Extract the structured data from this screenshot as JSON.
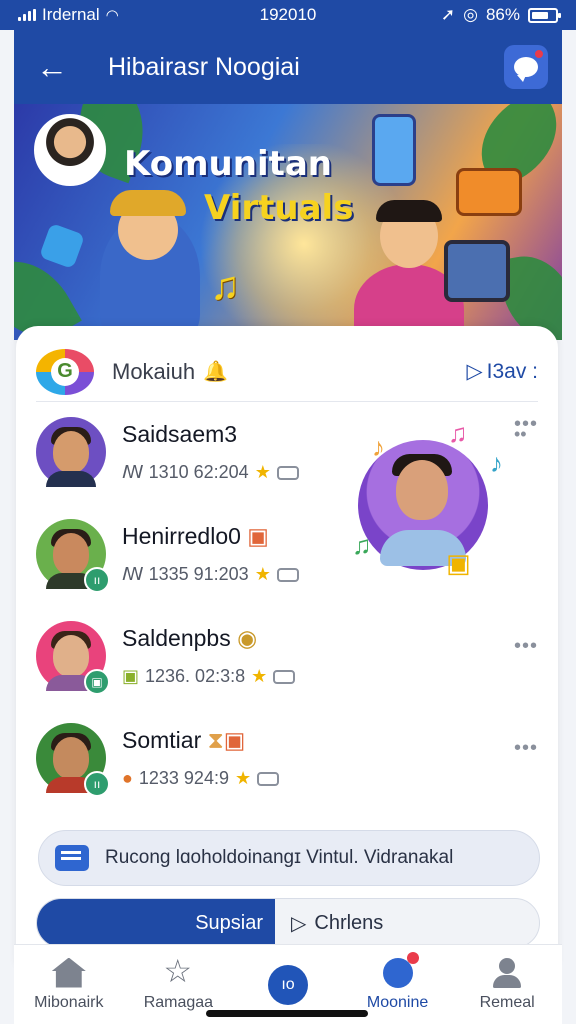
{
  "status_bar": {
    "carrier": "Irdernal",
    "time": "192010",
    "battery": "86%"
  },
  "header": {
    "title": "Hibairasr Noogiai"
  },
  "hero": {
    "title_line1": "Komunitan",
    "title_line2": "Virtuals"
  },
  "card": {
    "label": "Mokaiuh",
    "view_label": "I3av :"
  },
  "rows": [
    {
      "name": "Saidsaem3",
      "meta": "ꟿ 1310 62:204"
    },
    {
      "name": "Henirredlo0",
      "meta": "ꟿ 1335 91:203"
    },
    {
      "name": "Saldenpbs",
      "meta": "1236. 02:3:8"
    },
    {
      "name": "Somtiar",
      "meta": "1233 924:9"
    }
  ],
  "info": {
    "text": "Rucong lɑoholdoinangɪ Vintul. Vidranakal"
  },
  "actions": {
    "primary": "Supsiar",
    "secondary": "Chrlens"
  },
  "bottom_nav": [
    {
      "label": "Mibonairk",
      "icon": "home-icon"
    },
    {
      "label": "Ramagaa",
      "icon": "star-icon"
    },
    {
      "label": "",
      "icon": "center-action-icon",
      "center_text": "ıo"
    },
    {
      "label": "Moonine",
      "icon": "globe-icon"
    },
    {
      "label": "Remeal",
      "icon": "user-icon"
    }
  ],
  "colors": {
    "primary": "#1f4aa5",
    "accent_green": "#2e9d6e",
    "star": "#f0b400",
    "badge_red": "#ea3b4a"
  }
}
